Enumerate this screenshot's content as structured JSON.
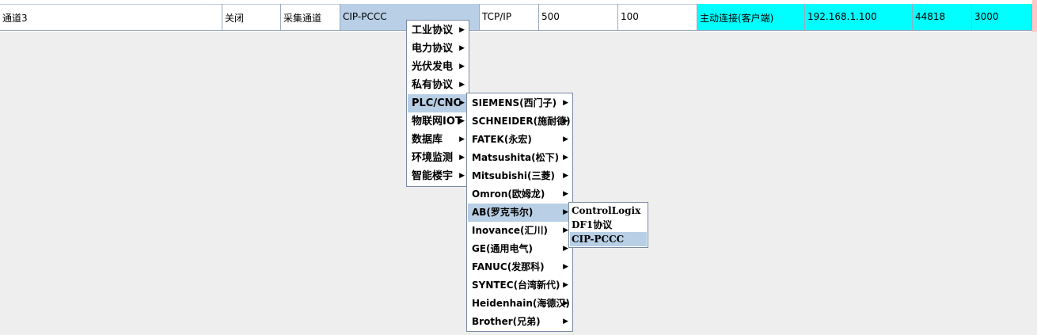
{
  "table_row": {
    "cells": [
      "通道3",
      "关闭",
      "采集通道",
      "CIP-PCCC",
      "TCP/IP",
      "500",
      "100",
      "主动连接(客户端)",
      "192.168.1.100",
      "44818",
      "3000"
    ]
  },
  "menu_level1": {
    "items": [
      "工业协议",
      "电力协议",
      "光伏发电",
      "私有协议",
      "PLC/CNC",
      "物联网IOT",
      "数据库",
      "环境监测",
      "智能楼宇"
    ]
  },
  "menu_level2": {
    "items": [
      "SIEMENS(西门子)",
      "SCHNEIDER(施耐德)",
      "FATEK(永宏)",
      "Matsushita(松下)",
      "Mitsubishi(三菱)",
      "Omron(欧姆龙)",
      "AB(罗克韦尔)",
      "Inovance(汇川)",
      "GE(通用电气)",
      "FANUC(发那科)",
      "SYNTEC(台湾新代)",
      "Heidenhain(海德汉)",
      "Brother(兄弟)"
    ]
  },
  "menu_level3": {
    "items": [
      "ControlLogix",
      "DF1协议",
      "CIP-PCCC"
    ]
  },
  "icons": {
    "submenu_arrow": "triangle-right"
  },
  "colors": {
    "selection": "#b8cfe5",
    "highlight_cell": "#00ffff"
  }
}
